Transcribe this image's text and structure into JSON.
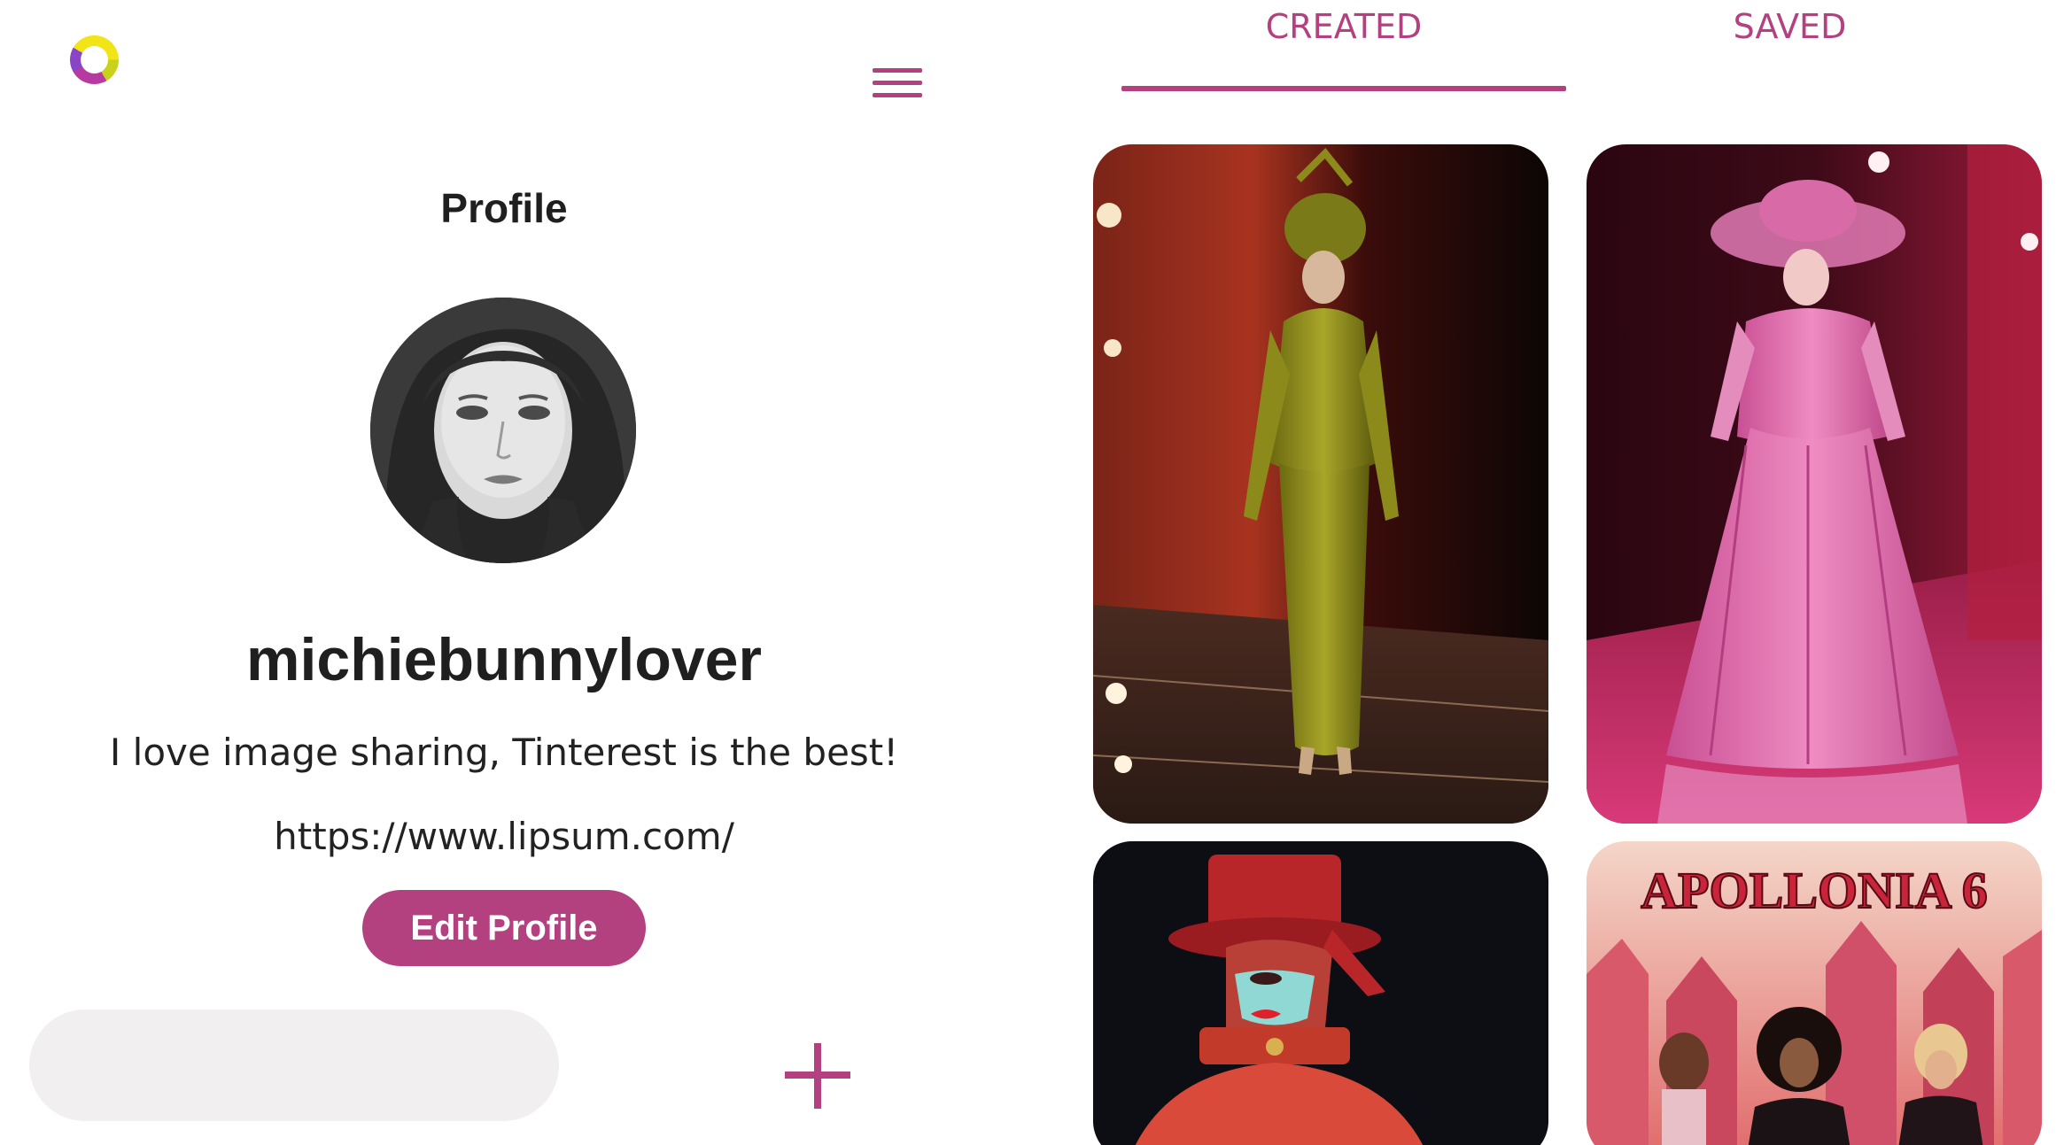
{
  "app": {
    "logo_icon": "ring-logo-icon",
    "menu_icon": "hamburger-menu-icon"
  },
  "profile": {
    "heading": "Profile",
    "username": "michiebunnylover",
    "bio": "I love image sharing, Tinterest is the best!",
    "website": "https://www.lipsum.com/",
    "edit_label": "Edit Profile"
  },
  "bottom_bar": {
    "search_value": "",
    "add_icon": "plus-icon"
  },
  "tabs": [
    {
      "label": "CREATED",
      "active": true
    },
    {
      "label": "SAVED",
      "active": false
    }
  ],
  "pins": [
    {
      "description": "runway model in olive satin suit"
    },
    {
      "description": "runway model in pink pleated gown"
    },
    {
      "description": "model in red hat with face mask"
    },
    {
      "description": "band album cover"
    }
  ],
  "pin_album_text": "APOLLONIA 6",
  "colors": {
    "accent": "#b3407f",
    "search_background": "#f2eff0",
    "text": "#1f1f1f"
  }
}
